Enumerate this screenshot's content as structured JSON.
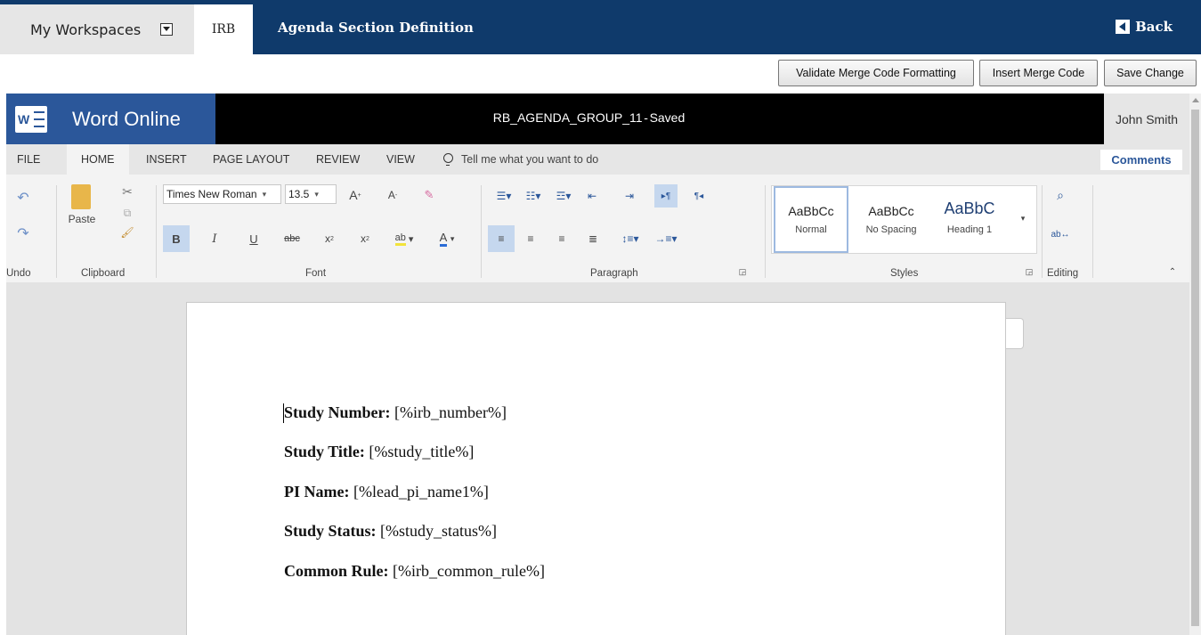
{
  "topbar": {
    "workspaces_label": "My Workspaces",
    "module_tab": "IRB",
    "page_title": "Agenda Section Definition",
    "back_label": "Back"
  },
  "actions": {
    "validate_label": "Validate Merge Code Formatting",
    "insert_label": "Insert Merge Code",
    "save_label": "Save Change"
  },
  "word": {
    "app_name": "Word Online",
    "doc_name": "RB_AGENDA_GROUP_11",
    "doc_status_sep": "-",
    "doc_status": "Saved",
    "user": "John Smith",
    "tabs": [
      "FILE",
      "HOME",
      "INSERT",
      "PAGE LAYOUT",
      "REVIEW",
      "VIEW"
    ],
    "tell_me": "Tell me what you want to do",
    "comments": "Comments",
    "groups": {
      "undo": "Undo",
      "clipboard": "Clipboard",
      "font": "Font",
      "paragraph": "Paragraph",
      "styles": "Styles",
      "editing": "Editing"
    },
    "paste_label": "Paste",
    "font_name": "Times New Roman",
    "font_size": "13.5",
    "styles": [
      {
        "sample": "AaBbCc",
        "name": "Normal"
      },
      {
        "sample": "AaBbCc",
        "name": "No Spacing"
      },
      {
        "sample": "AaBbC",
        "name": "Heading 1"
      }
    ]
  },
  "document": {
    "lines": [
      {
        "label": "Study Number:",
        "value": "[%irb_number%]"
      },
      {
        "label": "Study Title:",
        "value": "[%study_title%]"
      },
      {
        "label": "PI Name:",
        "value": "[%lead_pi_name1%]"
      },
      {
        "label": "Study Status:",
        "value": "[%study_status%]"
      },
      {
        "label": "Common Rule:",
        "value": "[%irb_common_rule%]"
      }
    ]
  }
}
